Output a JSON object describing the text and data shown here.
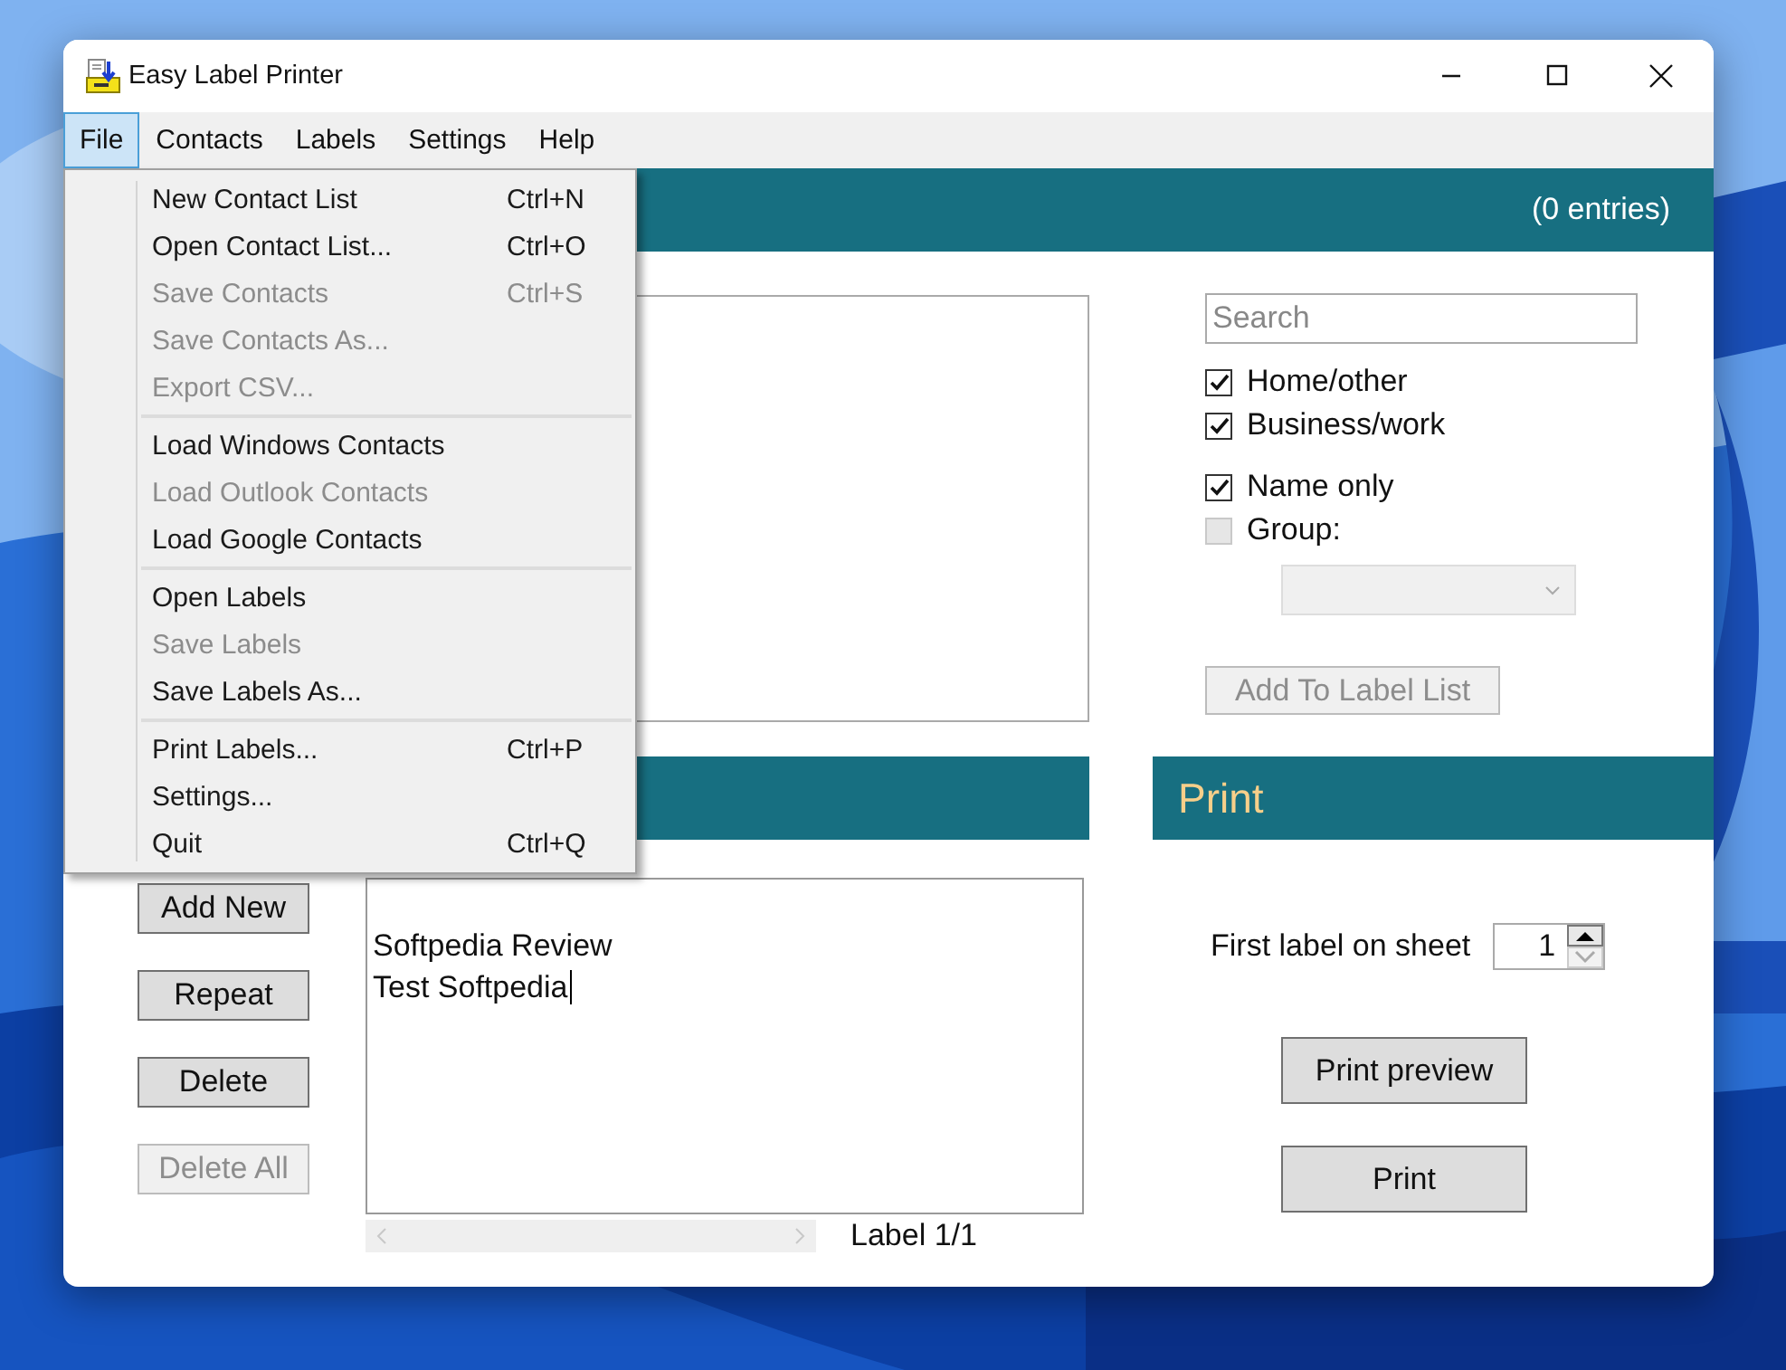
{
  "window": {
    "title": "Easy Label Printer"
  },
  "menu_bar": [
    {
      "label": "File",
      "selected": true
    },
    {
      "label": "Contacts",
      "selected": false
    },
    {
      "label": "Labels",
      "selected": false
    },
    {
      "label": "Settings",
      "selected": false
    },
    {
      "label": "Help",
      "selected": false
    }
  ],
  "file_menu": {
    "groups": [
      [
        {
          "label": "New Contact List",
          "shortcut": "Ctrl+N",
          "disabled": false
        },
        {
          "label": "Open Contact List...",
          "shortcut": "Ctrl+O",
          "disabled": false
        },
        {
          "label": "Save Contacts",
          "shortcut": "Ctrl+S",
          "disabled": true
        },
        {
          "label": "Save Contacts As...",
          "disabled": true
        },
        {
          "label": "Export CSV...",
          "disabled": true
        }
      ],
      [
        {
          "label": "Load Windows Contacts",
          "disabled": false
        },
        {
          "label": "Load Outlook Contacts",
          "disabled": true
        },
        {
          "label": "Load Google Contacts",
          "disabled": false
        }
      ],
      [
        {
          "label": "Open Labels",
          "disabled": false
        },
        {
          "label": "Save Labels",
          "disabled": true
        },
        {
          "label": "Save Labels As...",
          "disabled": false
        }
      ],
      [
        {
          "label": "Print Labels...",
          "shortcut": "Ctrl+P",
          "disabled": false
        },
        {
          "label": "Settings...",
          "disabled": false
        },
        {
          "label": "Quit",
          "shortcut": "Ctrl+Q",
          "disabled": false
        }
      ]
    ]
  },
  "contacts": {
    "header": "(0 entries)",
    "search": {
      "placeholder": "Search"
    },
    "filters": [
      {
        "label": "Home/other",
        "checked": true,
        "disabled": false
      },
      {
        "label": "Business/work",
        "checked": true,
        "disabled": false
      },
      {
        "label": "Name only",
        "checked": true,
        "disabled": false
      },
      {
        "label": "Group:",
        "checked": false,
        "disabled": true
      }
    ],
    "group_dropdown": {
      "disabled": true
    },
    "add_button": {
      "label": "Add To Label List",
      "disabled": true
    }
  },
  "labels": {
    "buttons": [
      {
        "label": "Add New",
        "disabled": false
      },
      {
        "label": "Repeat",
        "disabled": false
      },
      {
        "label": "Delete",
        "disabled": false
      },
      {
        "label": "Delete All",
        "disabled": true
      }
    ],
    "label_lines": [
      "Softpedia Review",
      "Test Softpedia"
    ],
    "counter": "Label 1/1"
  },
  "print": {
    "header": "Print",
    "first_label": {
      "label": "First label on sheet",
      "value": "1"
    },
    "buttons": [
      {
        "label": "Print preview",
        "disabled": false
      },
      {
        "label": "Print",
        "disabled": false
      }
    ]
  }
}
